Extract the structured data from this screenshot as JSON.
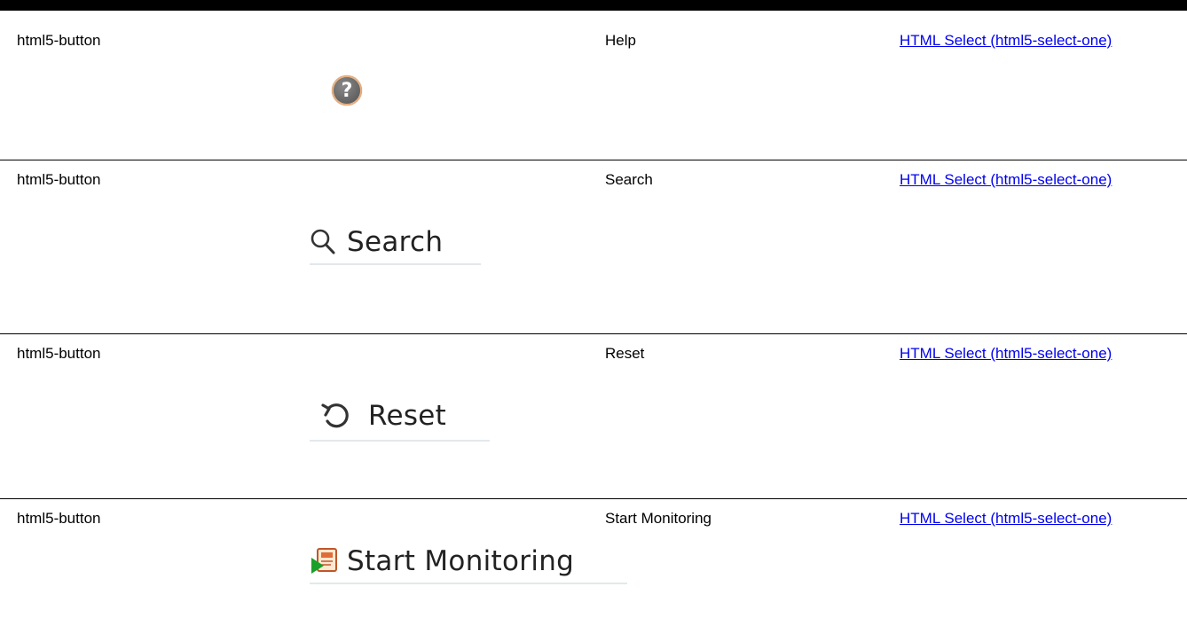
{
  "rows": [
    {
      "type": "html5-button",
      "name": "Help",
      "link": "HTML Select (html5-select-one)",
      "image_icon": "help-icon"
    },
    {
      "type": "html5-button",
      "name": "Search",
      "link": "HTML Select (html5-select-one)",
      "image_icon": "search-icon",
      "image_label": "Search"
    },
    {
      "type": "html5-button",
      "name": "Reset",
      "link": "HTML Select (html5-select-one)",
      "image_icon": "reset-icon",
      "image_label": "Reset"
    },
    {
      "type": "html5-button",
      "name": "Start Monitoring",
      "link": "HTML Select (html5-select-one)",
      "image_icon": "start-monitoring-icon",
      "image_label": "Start Monitoring"
    }
  ],
  "colors": {
    "link": "#0000ee",
    "divider": "#000000"
  }
}
